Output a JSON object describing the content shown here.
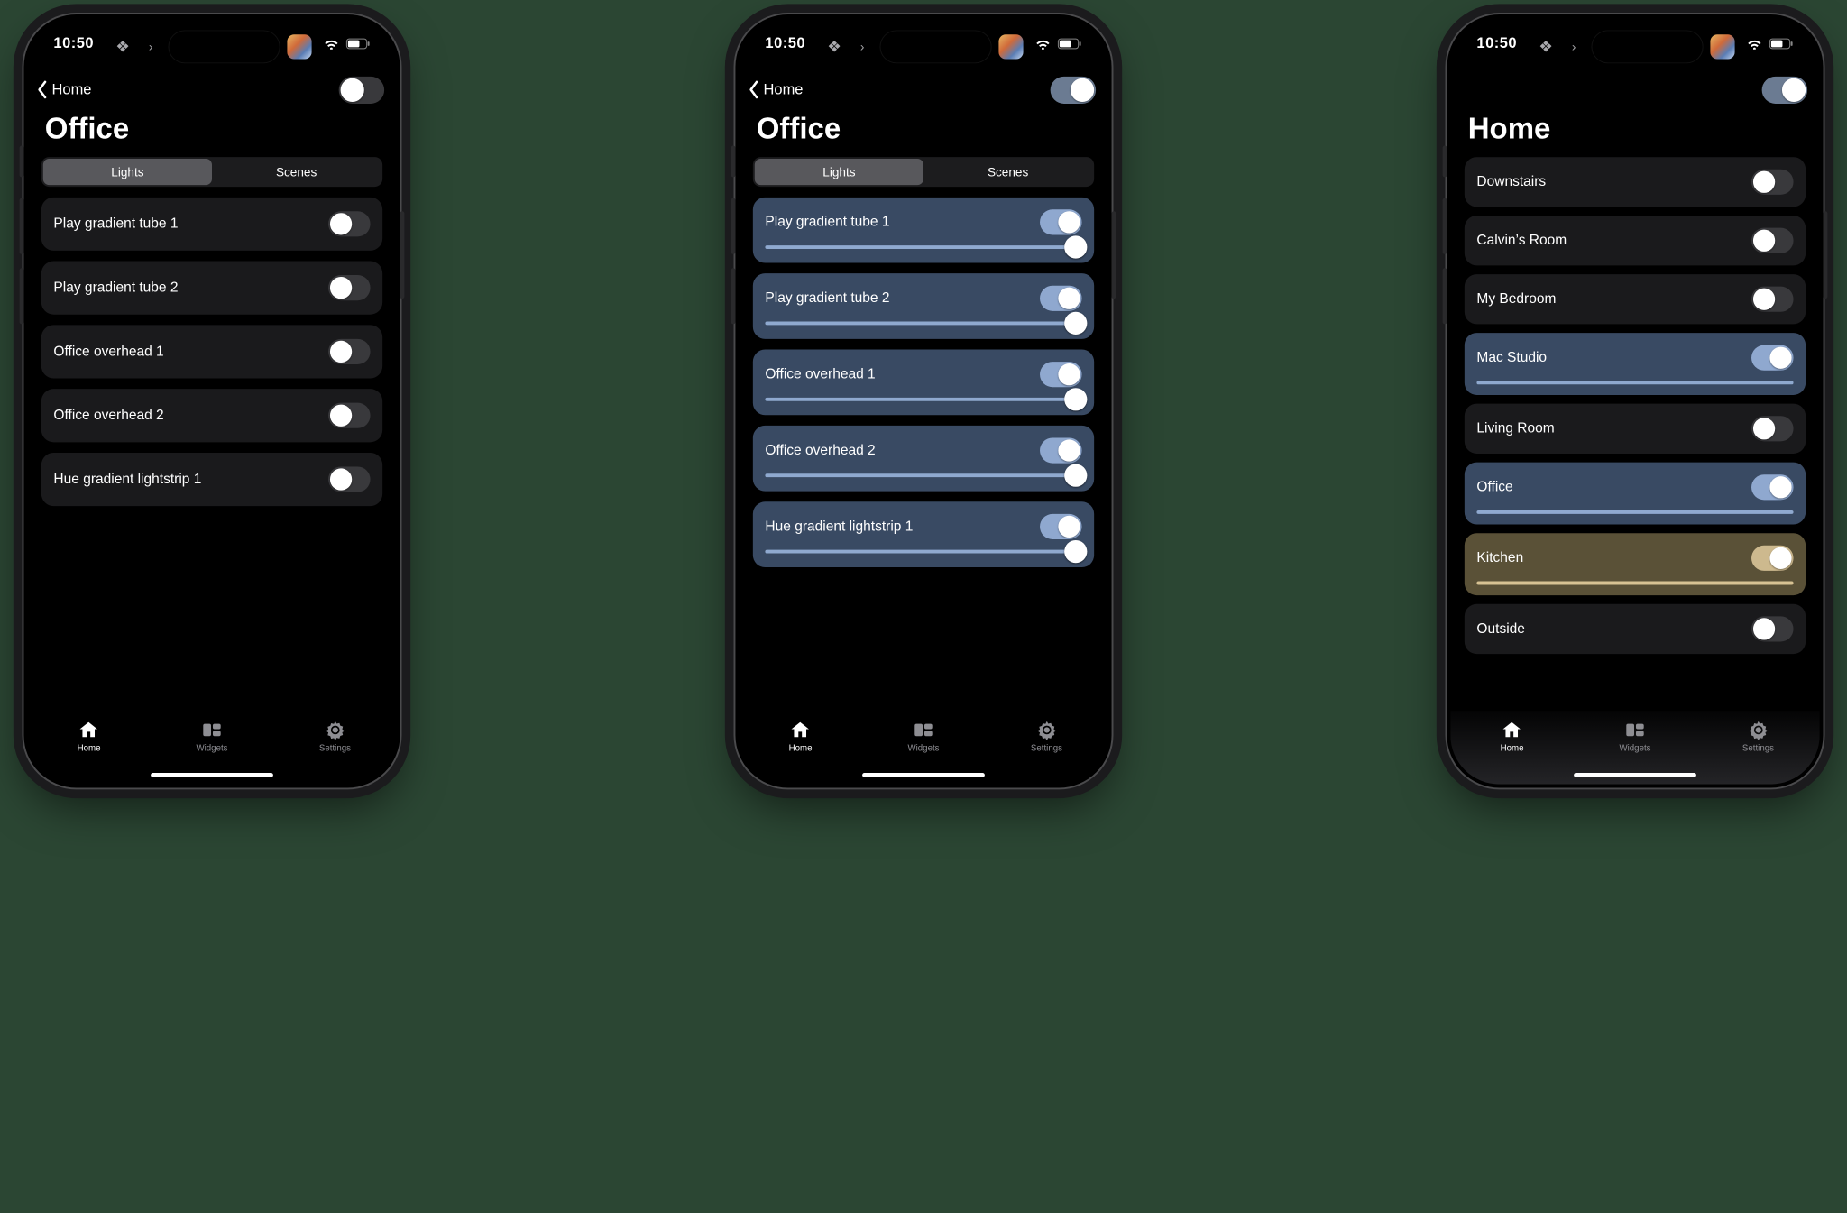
{
  "status": {
    "time": "10:50"
  },
  "tabs": {
    "home": "Home",
    "widgets": "Widgets",
    "settings": "Settings"
  },
  "seg": {
    "lights": "Lights",
    "scenes": "Scenes"
  },
  "phone1": {
    "back": "Home",
    "title": "Office",
    "lights": [
      {
        "label": "Play gradient tube 1"
      },
      {
        "label": "Play gradient tube 2"
      },
      {
        "label": "Office overhead 1"
      },
      {
        "label": "Office overhead 2"
      },
      {
        "label": "Hue gradient lightstrip 1"
      }
    ]
  },
  "phone2": {
    "back": "Home",
    "title": "Office",
    "lights": [
      {
        "label": "Play gradient tube 1"
      },
      {
        "label": "Play gradient tube 2"
      },
      {
        "label": "Office overhead 1"
      },
      {
        "label": "Office overhead 2"
      },
      {
        "label": "Hue gradient lightstrip 1"
      }
    ]
  },
  "phone3": {
    "title": "Home",
    "rooms": [
      {
        "label": "Downstairs",
        "on": false
      },
      {
        "label": "Calvin’s Room",
        "on": false
      },
      {
        "label": "My Bedroom",
        "on": false
      },
      {
        "label": "Mac Studio",
        "on": true,
        "tint": "blue"
      },
      {
        "label": "Living Room",
        "on": false
      },
      {
        "label": "Office",
        "on": true,
        "tint": "blue"
      },
      {
        "label": "Kitchen",
        "on": true,
        "tint": "tan"
      },
      {
        "label": "Outside",
        "on": false
      }
    ]
  }
}
